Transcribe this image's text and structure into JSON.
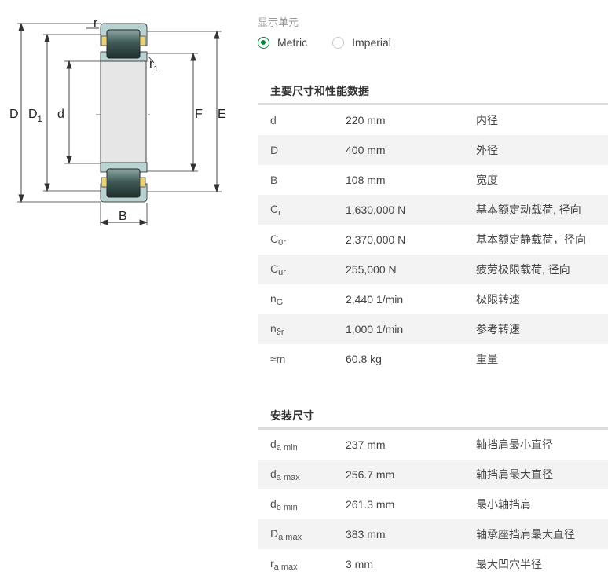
{
  "drawing": {
    "labels": {
      "D": "D",
      "D1": "D",
      "D1_sub": "1",
      "d": "d",
      "F": "F",
      "E": "E",
      "B": "B",
      "r": "r",
      "r1": "r",
      "r1_sub": "1"
    }
  },
  "units": {
    "title": "显示单元",
    "options": [
      {
        "label": "Metric",
        "checked": true
      },
      {
        "label": "Imperial",
        "checked": false
      }
    ]
  },
  "main_data": {
    "title": "主要尺寸和性能数据",
    "rows": [
      {
        "sym": "d",
        "sub": "",
        "value": "220 mm",
        "desc": "内径"
      },
      {
        "sym": "D",
        "sub": "",
        "value": "400 mm",
        "desc": "外径"
      },
      {
        "sym": "B",
        "sub": "",
        "value": "108 mm",
        "desc": "宽度"
      },
      {
        "sym": "C",
        "sub": "r",
        "value": "1,630,000 N",
        "desc": "基本额定动载荷, 径向"
      },
      {
        "sym": "C",
        "sub": "0r",
        "value": "2,370,000 N",
        "desc": "基本额定静载荷，径向"
      },
      {
        "sym": "C",
        "sub": "ur",
        "value": "255,000 N",
        "desc": "疲劳极限载荷, 径向"
      },
      {
        "sym": "n",
        "sub": "G",
        "value": "2,440 1/min",
        "desc": "极限转速"
      },
      {
        "sym": "n",
        "sub": "ϑr",
        "value": "1,000 1/min",
        "desc": "参考转速"
      },
      {
        "sym": "≈m",
        "sub": "",
        "value": "60.8 kg",
        "desc": "重量"
      }
    ]
  },
  "mounting": {
    "title": "安装尺寸",
    "rows": [
      {
        "sym": "d",
        "sub": "a min",
        "value": "237 mm",
        "desc": "轴挡肩最小直径"
      },
      {
        "sym": "d",
        "sub": "a max",
        "value": "256.7 mm",
        "desc": "轴挡肩最大直径"
      },
      {
        "sym": "d",
        "sub": "b min",
        "value": "261.3 mm",
        "desc": "最小轴挡肩"
      },
      {
        "sym": "D",
        "sub": "a max",
        "value": "383 mm",
        "desc": "轴承座挡肩最大直径"
      },
      {
        "sym": "r",
        "sub": "a max",
        "value": "3 mm",
        "desc": "最大凹穴半径"
      }
    ]
  }
}
